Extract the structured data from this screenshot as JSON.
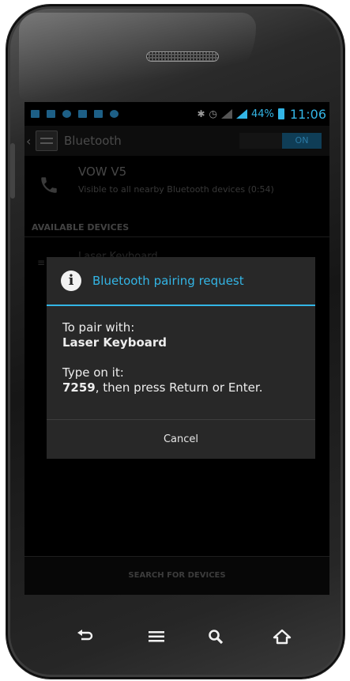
{
  "status_bar": {
    "battery_percent": "44%",
    "time": "11:06"
  },
  "action_bar": {
    "title": "Bluetooth",
    "toggle_label": "ON"
  },
  "device": {
    "name": "VOW V5",
    "visibility": "Visible to all nearby Bluetooth devices (0:54)"
  },
  "available_devices": {
    "header": "AVAILABLE DEVICES",
    "item_label": "Laser Keyboard"
  },
  "dialog": {
    "title": "Bluetooth pairing request",
    "pair_with_label": "To pair with:",
    "device_name": "Laser Keyboard",
    "type_on_label": "Type on it:",
    "pin": "7259",
    "pin_suffix": ", then press Return or Enter.",
    "cancel_label": "Cancel"
  },
  "bottom_bar": {
    "search_label": "SEARCH FOR DEVICES"
  },
  "colors": {
    "accent": "#33b5e5",
    "dialog_background": "#282828",
    "screen_background": "#000000"
  },
  "icons": {
    "nav_keys": [
      "back-icon",
      "menu-icon",
      "search-icon",
      "home-icon"
    ],
    "dialog": "info-icon",
    "device": "phone-icon"
  }
}
